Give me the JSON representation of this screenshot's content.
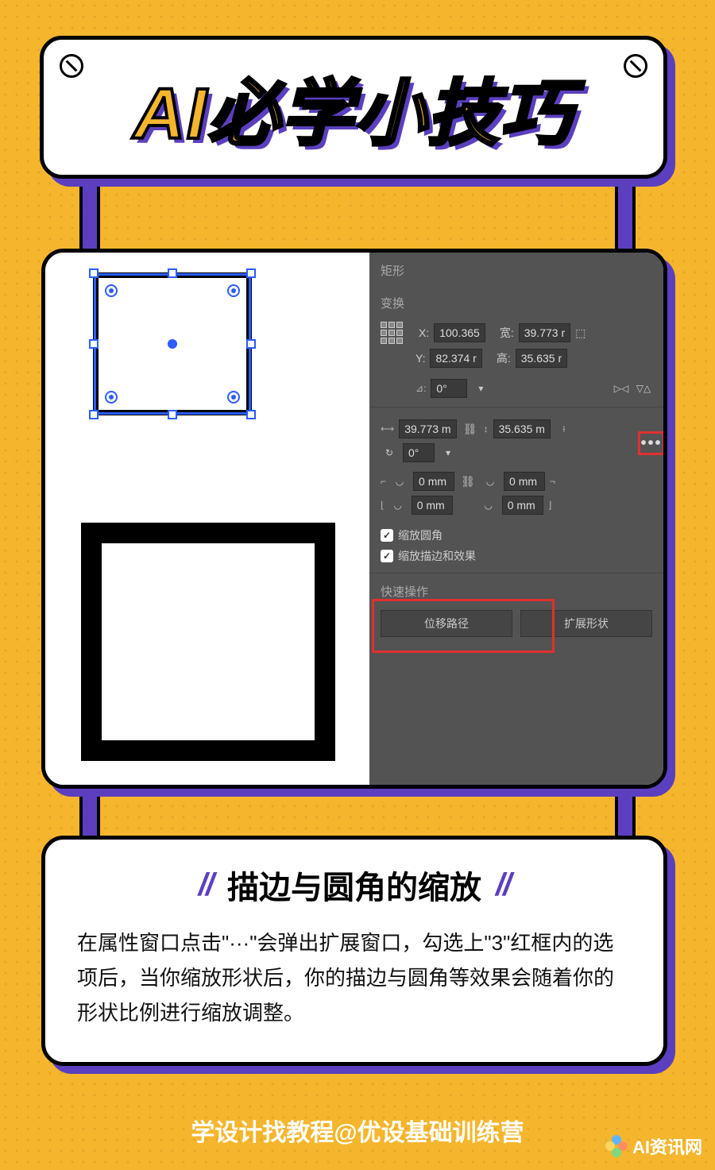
{
  "title": "AI必学小技巧",
  "panel": {
    "shape_label": "矩形",
    "transform_label": "变换",
    "x_label": "X:",
    "x_value": "100.365",
    "y_label": "Y:",
    "y_value": "82.374 r",
    "w_label": "宽:",
    "w_value": "39.773 r",
    "h_label": "高:",
    "h_value": "35.635 r",
    "rotate_value": "0°",
    "more_icon": "•••",
    "width_detail": "39.773 m",
    "height_detail": "35.635 m",
    "rotate2": "0°",
    "corner_value": "0 mm",
    "checkbox1_label": "缩放圆角",
    "checkbox2_label": "缩放描边和效果",
    "quick_actions_label": "快速操作",
    "button1": "位移路径",
    "button2": "扩展形状"
  },
  "text_card": {
    "heading": "描边与圆角的缩放",
    "body": "在属性窗口点击\"···\"会弹出扩展窗口，勾选上\"3\"红框内的选项后，当你缩放形状后，你的描边与圆角等效果会随着你的形状比例进行缩放调整。"
  },
  "footer": "学设计找教程@优设基础训练营",
  "watermark": "AI资讯网"
}
